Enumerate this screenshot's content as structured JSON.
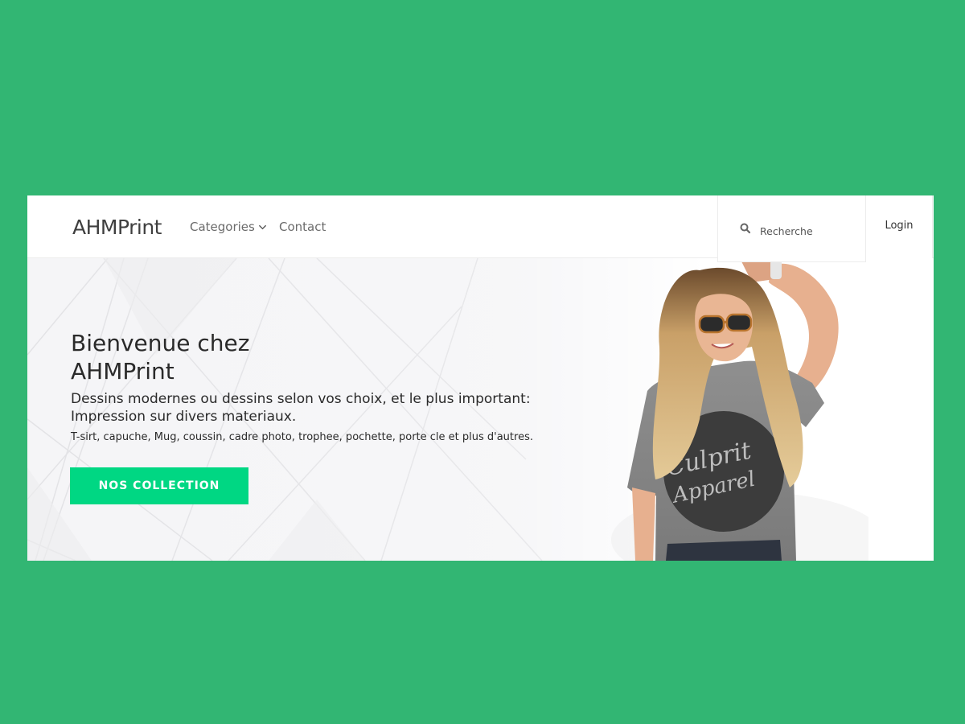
{
  "navbar": {
    "brand": "AHMPrint",
    "categories_label": "Categories",
    "contact_label": "Contact",
    "login_label": "Login"
  },
  "search": {
    "placeholder": "Recherche",
    "icon": "search-icon"
  },
  "hero": {
    "title": "Bienvenue chez AHMPrint",
    "subtitle": "Dessins modernes ou dessins selon vos choix, et le plus important: Impression sur divers materiaux.",
    "description": "T-sirt, capuche, Mug, coussin, cadre photo, trophee, pochette, porte cle et plus d'autres.",
    "cta_label": "NOS COLLECTION",
    "shirt_text_line1": "Culprit",
    "shirt_text_line2": "Apparel"
  },
  "colors": {
    "page_background": "#32b673",
    "cta_background": "#00d783",
    "text_dark": "#2a2a2a"
  }
}
